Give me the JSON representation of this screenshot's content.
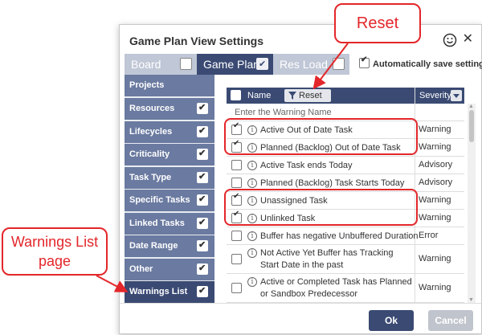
{
  "dialog": {
    "title": "Game Plan View Settings",
    "tabs": [
      {
        "label": "Board",
        "checked": false
      },
      {
        "label": "Game Plan",
        "checked": true
      },
      {
        "label": "Res Load",
        "checked": false
      }
    ],
    "autosave_label": "Automatically save settings"
  },
  "sidebar": {
    "items": [
      {
        "label": "Projects",
        "checkbox": false,
        "active": false
      },
      {
        "label": "Resources",
        "checkbox": true,
        "active": false
      },
      {
        "label": "Lifecycles",
        "checkbox": true,
        "active": false
      },
      {
        "label": "Criticality",
        "checkbox": true,
        "active": false
      },
      {
        "label": "Task Type",
        "checkbox": true,
        "active": false
      },
      {
        "label": "Specific Tasks",
        "checkbox": true,
        "active": false
      },
      {
        "label": "Linked Tasks",
        "checkbox": true,
        "active": false
      },
      {
        "label": "Date Range",
        "checkbox": true,
        "active": false
      },
      {
        "label": "Other",
        "checkbox": true,
        "active": false
      },
      {
        "label": "Warnings List",
        "checkbox": true,
        "active": true
      }
    ]
  },
  "grid": {
    "header": {
      "name": "Name",
      "reset": "Reset",
      "severity": "Severity"
    },
    "filter_placeholder": "Enter the Warning Name",
    "rows": [
      {
        "name": "Active Out of Date Task",
        "severity": "Warning",
        "checked": true
      },
      {
        "name": "Planned (Backlog) Out of Date Task",
        "severity": "Warning",
        "checked": true
      },
      {
        "name": "Active Task ends Today",
        "severity": "Advisory",
        "checked": false
      },
      {
        "name": "Planned (Backlog) Task Starts Today",
        "severity": "Advisory",
        "checked": false
      },
      {
        "name": "Unassigned Task",
        "severity": "Warning",
        "checked": true
      },
      {
        "name": "Unlinked Task",
        "severity": "Warning",
        "checked": true
      },
      {
        "name": "Buffer has negative Unbuffered Duration",
        "severity": "Error",
        "checked": false
      },
      {
        "name": "Not Active Yet Buffer has Tracking Start Date in the past",
        "severity": "Warning",
        "checked": false
      },
      {
        "name": "Active or Completed Task has Planned or Sandbox Predecessor",
        "severity": "Warning",
        "checked": false
      }
    ]
  },
  "footer": {
    "ok": "Ok",
    "cancel": "Cancel"
  },
  "annotations": {
    "reset": "Reset",
    "warnings_list_line1": "Warnings List",
    "warnings_list_line2": "page"
  },
  "colors": {
    "header_navy": "#3a4a73",
    "sidebar_blue": "#6a7aa0",
    "annotation_red": "#e3262a"
  }
}
